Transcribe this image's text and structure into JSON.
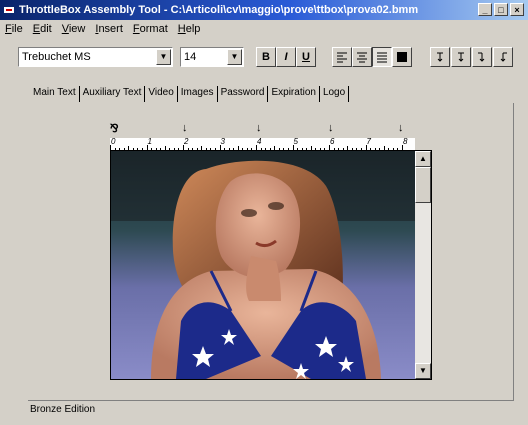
{
  "window": {
    "title": "ThrottleBox Assembly Tool - C:\\Articoli\\cv\\maggio\\prove\\ttbox\\prova02.bmm"
  },
  "menu": [
    {
      "u": "F",
      "rest": "ile"
    },
    {
      "u": "E",
      "rest": "dit"
    },
    {
      "u": "V",
      "rest": "iew"
    },
    {
      "u": "I",
      "rest": "nsert"
    },
    {
      "u": "F",
      "rest": "ormat",
      "pre": ""
    },
    {
      "u": "H",
      "rest": "elp"
    }
  ],
  "toolbar": {
    "font": "Trebuchet MS",
    "size": "14",
    "bold": "B",
    "italic": "I",
    "underline": "U",
    "align_icons": [
      "align-left-icon",
      "align-center-icon",
      "align-justify-icon",
      "align-right-icon"
    ],
    "para_icons": [
      "paragraph-down-icon",
      "paragraph-up-icon",
      "paragraph-left-icon",
      "paragraph-right-icon"
    ]
  },
  "tabs": [
    "Main Text",
    "Auxiliary Text",
    "Video",
    "Images",
    "Password",
    "Expiration",
    "Logo"
  ],
  "ruler": {
    "numbers": [
      "0",
      "1",
      "2",
      "3",
      "4",
      "5",
      "6",
      "7",
      "8"
    ]
  },
  "status": "Bronze Edition"
}
